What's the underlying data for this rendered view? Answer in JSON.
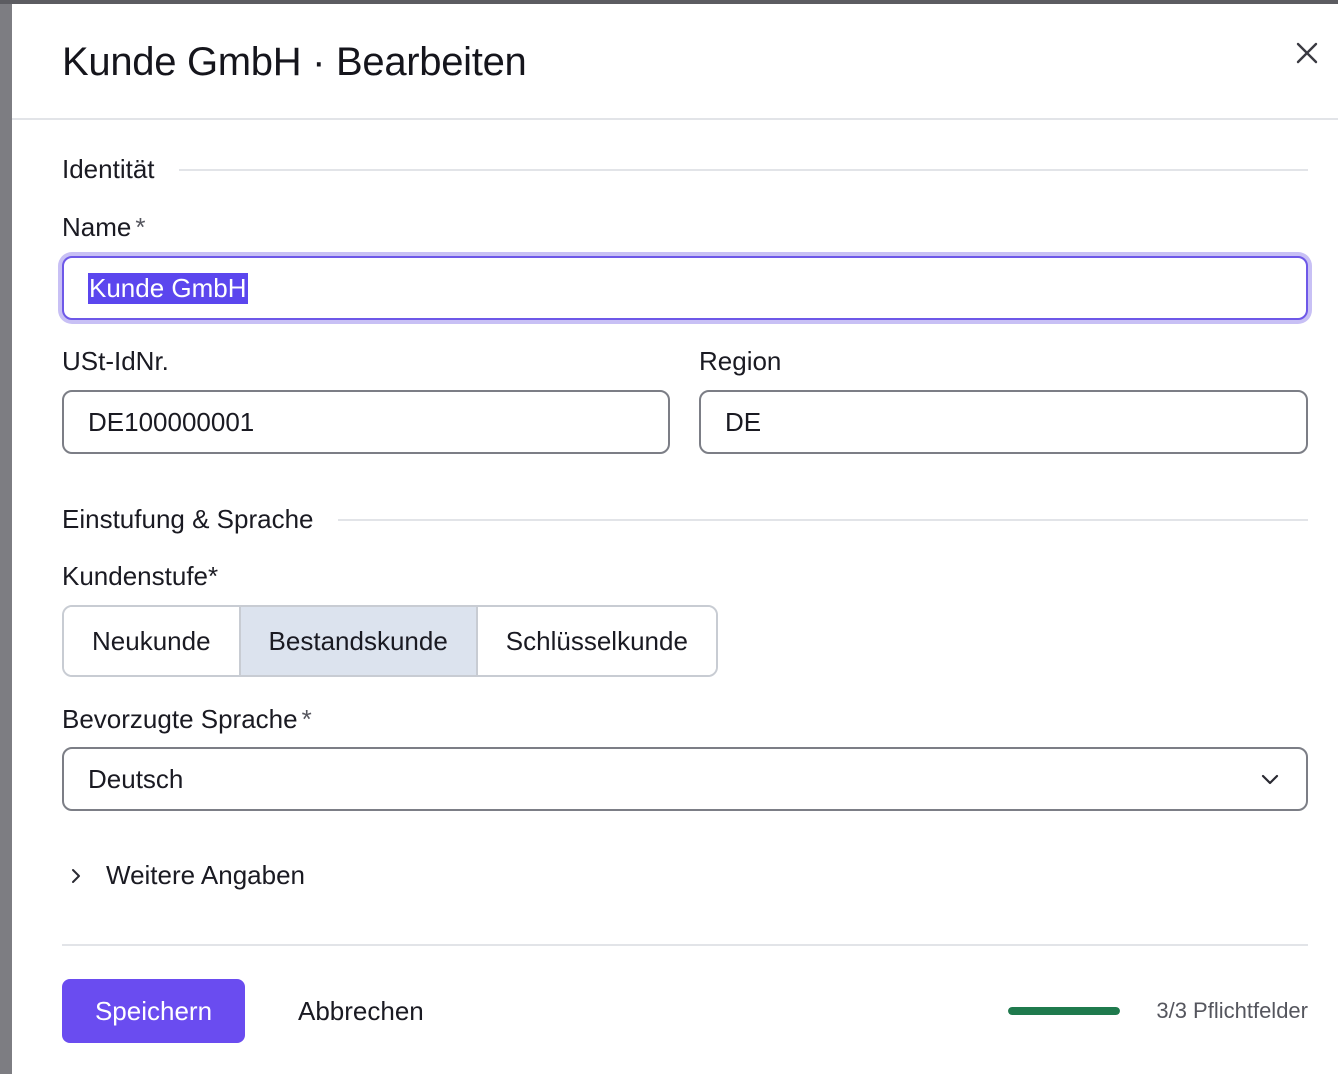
{
  "dialog": {
    "title": "Kunde GmbH · Bearbeiten",
    "close_icon": "close-icon"
  },
  "sections": {
    "identity": "Identität",
    "classification": "Einstufung & Sprache"
  },
  "fields": {
    "name": {
      "label": "Name",
      "required_mark": "*",
      "value": "Kunde GmbH"
    },
    "vat": {
      "label": "USt-IdNr.",
      "value": "DE100000001"
    },
    "region": {
      "label": "Region",
      "value": "DE"
    },
    "tier": {
      "label": "Kundenstufe*",
      "options": [
        "Neukunde",
        "Bestandskunde",
        "Schlüsselkunde"
      ],
      "selected": "Bestandskunde"
    },
    "language": {
      "label": "Bevorzugte Sprache",
      "required_mark": "*",
      "value": "Deutsch",
      "icon": "chevron-down-icon"
    }
  },
  "more": {
    "label": "Weitere Angaben",
    "icon": "chevron-right-icon"
  },
  "footer": {
    "save_label": "Speichern",
    "cancel_label": "Abbrechen",
    "progress_text": "3/3 Pflichtfelder",
    "progress_fraction": 1.0
  },
  "colors": {
    "accent": "#6a4cf0",
    "focus_ring": "#c8c0f5",
    "progress": "#1f7a4d",
    "segment_active": "#dce3ee"
  }
}
